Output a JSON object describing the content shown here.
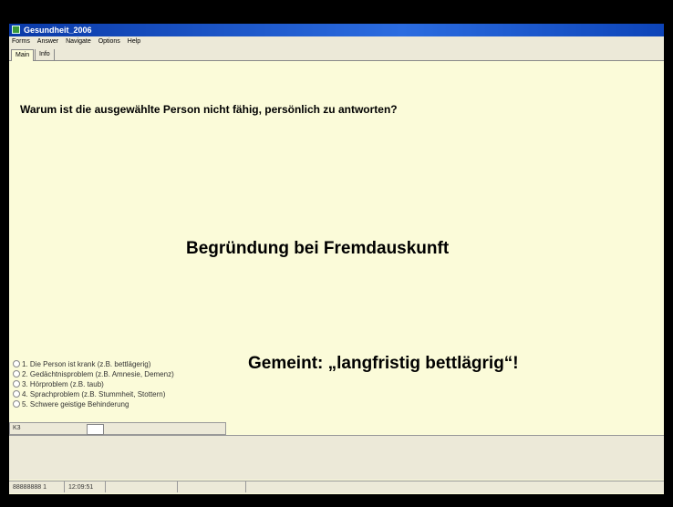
{
  "window": {
    "title": "Gesundheit_2006"
  },
  "menu": [
    "Forms",
    "Answer",
    "Navigate",
    "Options",
    "Help"
  ],
  "tabs": [
    "Main",
    "Info"
  ],
  "question": "Warum ist die ausgewählte Person nicht fähig, persönlich zu antworten?",
  "overlay": {
    "heading": "Begründung bei Fremdauskunft",
    "note": "Gemeint: „langfristig bettlägrig“!"
  },
  "options": [
    "1. Die Person ist krank (z.B. bettlägerig)",
    "2. Gedächtnisproblem (z.B. Amnesie, Demenz)",
    "3. Hörproblem (z.B. taub)",
    "4. Sprachproblem (z.B. Stummheit, Stottern)",
    "5. Schwere geistige Behinderung"
  ],
  "answer_field": {
    "label": "K3",
    "value": ""
  },
  "status": {
    "id": "88888888 1",
    "time": "12:09:51"
  }
}
